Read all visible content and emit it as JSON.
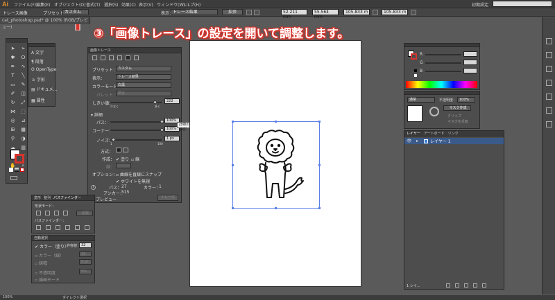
{
  "menubar": {
    "logo": "Ai",
    "items": [
      "ファイル(F)",
      "編集(E)",
      "オブジェクト(O)",
      "書式(T)",
      "選択(S)",
      "効果(C)",
      "表示(V)",
      "ウィンドウ(W)",
      "ヘルプ(H)"
    ],
    "workspace_label": "初期設定"
  },
  "controlbar": {
    "tool_label": "トレース画像",
    "preset_label": "プリセット：",
    "preset_value": "カスタム",
    "view_label": "表示：",
    "view_value": "トレース結果",
    "expand_button": "拡張",
    "x_value": "52.211 mm",
    "y_value": "55.564 mm",
    "w_value": "105.833 m",
    "h_value": "105.833 m"
  },
  "document_tab": "cat_photoshop.psd* @ 100% (RGB/プレビュー)",
  "annotation": "③「画像トレース」の設定を開いて調整します。",
  "trace_panel": {
    "title": "画像トレース",
    "preset_label": "プリセット：",
    "preset_value": "カスタム",
    "view_label": "表示：",
    "view_value": "トレース結果",
    "mode_label": "カラーモード：",
    "mode_value": "白黒",
    "palette_label": "パレット：",
    "palette_value": "限定",
    "threshold_label": "しきい値：",
    "threshold_value": "222",
    "low_label": "少なく",
    "high_label": "多く",
    "advanced_label": "詳細",
    "paths_label": "パス：",
    "paths_value": "100%",
    "corners_label": "コーナー：",
    "corners_value": "100%",
    "noise_label": "ノイズ：",
    "noise_value": "1 px",
    "noise_min": "1",
    "noise_max": "100",
    "method_label": "方式：",
    "create_label": "作成：",
    "fill_label": "塗り",
    "stroke_label": "線",
    "stroke_width_label": "線：",
    "options_label": "オプション：",
    "snap_label": "曲線を直線にスナップ",
    "ignore_white_label": "ホワイトを無視",
    "paths_count_label": "パス：",
    "paths_count": "27",
    "colors_label": "カラー：",
    "colors_count": "1",
    "anchors_label": "アンカー：",
    "anchors_count": "515",
    "preview_label": "プレビュー",
    "trace_button": "トレース"
  },
  "tooltip": "詳細の許容値（値が大きいほど精密）",
  "char_panel": {
    "items": [
      "文字",
      "段落",
      "OpenType",
      "字形",
      "ドキュメ...",
      "属性"
    ]
  },
  "pathfinder_panel": {
    "tabs": [
      "変形",
      "整列",
      "パスファインダー"
    ],
    "shape_modes": "形状モード：",
    "expand": "拡張",
    "pathfinders": "パスファインダー："
  },
  "magic_wand_panel": {
    "title": "自動選択",
    "fill_color": "カラー（塗り）",
    "stroke_color": "カラー（線）",
    "stroke_weight": "線幅",
    "opacity": "不透明度",
    "blend_mode": "描画モード",
    "tolerance": "許容値：",
    "fill_tol": "32",
    "stroke_tol": "32",
    "weight_tol": "5 pt",
    "opacity_tol": "5%"
  },
  "color_panel": {
    "r": "R",
    "g": "G",
    "b": "B"
  },
  "transparency_panel": {
    "mode": "通常",
    "opacity_label": "不透明度：",
    "opacity": "100%",
    "make_mask": "マスク作成",
    "clip": "クリップ",
    "invert": "マスクを反転"
  },
  "layers_panel": {
    "tabs": [
      "レイヤー",
      "アートボード",
      "リンク"
    ],
    "layer_name": "レイヤー 1",
    "footer": "1 レイ..."
  },
  "statusbar": {
    "zoom": "100%",
    "tool": "ダイレクト選択"
  },
  "colors": {
    "accent": "#5a7fe8",
    "annotation": "#d9342b"
  }
}
